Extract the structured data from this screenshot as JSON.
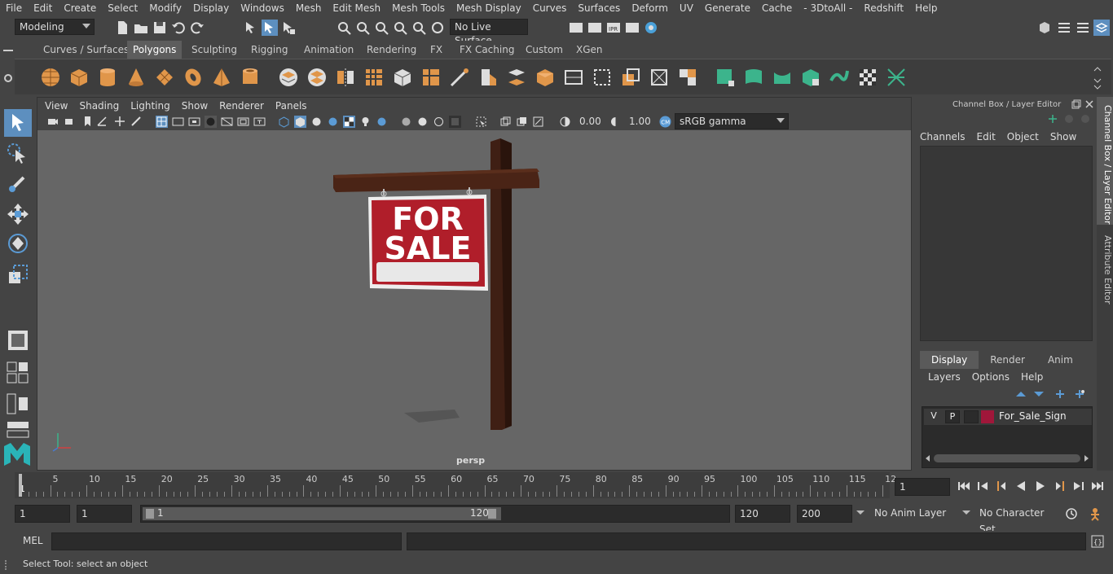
{
  "menubar": {
    "items": [
      "File",
      "Edit",
      "Create",
      "Select",
      "Modify",
      "Display",
      "Windows",
      "Mesh",
      "Edit Mesh",
      "Mesh Tools",
      "Mesh Display",
      "Curves",
      "Surfaces",
      "Deform",
      "UV",
      "Generate",
      "Cache",
      "- 3DtoAll -",
      "Redshift",
      "Help"
    ]
  },
  "statusline": {
    "mode": "Modeling",
    "live_surface": "No Live Surface"
  },
  "shelf": {
    "tabs": [
      "Curves / Surfaces",
      "Polygons",
      "Sculpting",
      "Rigging",
      "Animation",
      "Rendering",
      "FX",
      "FX Caching",
      "Custom",
      "XGen"
    ],
    "active_tab": "Polygons"
  },
  "viewport": {
    "menu": [
      "View",
      "Shading",
      "Lighting",
      "Show",
      "Renderer",
      "Panels"
    ],
    "exposure": "0.00",
    "gamma": "1.00",
    "color_space": "sRGB gamma",
    "camera": "persp",
    "sign_line1": "FOR",
    "sign_line2": "SALE"
  },
  "channel_box": {
    "title": "Channel Box / Layer Editor",
    "menu": [
      "Channels",
      "Edit",
      "Object",
      "Show"
    ],
    "layer_tabs": [
      "Display",
      "Render",
      "Anim"
    ],
    "active_layer_tab": "Display",
    "layer_menu": [
      "Layers",
      "Options",
      "Help"
    ],
    "layer": {
      "v": "V",
      "p": "P",
      "name": "For_Sale_Sign",
      "color": "#a0173a"
    }
  },
  "side_tabs": {
    "channel": "Channel Box / Layer Editor",
    "attribute": "Attribute Editor"
  },
  "timeslider": {
    "ticks": [
      "5",
      "10",
      "15",
      "20",
      "25",
      "30",
      "35",
      "40",
      "45",
      "50",
      "55",
      "60",
      "65",
      "70",
      "75",
      "80",
      "85",
      "90",
      "95",
      "100",
      "105",
      "110",
      "115",
      "12"
    ],
    "start_marker": "1",
    "current_frame": "1"
  },
  "range": {
    "start": "1",
    "playback_start": "1",
    "slider_start": "1",
    "slider_end": "120",
    "playback_end": "120",
    "end": "200",
    "anim_layer": "No Anim Layer",
    "character_set": "No Character Set"
  },
  "cmdline": {
    "label": "MEL"
  },
  "helpline": {
    "text": "Select Tool: select an object"
  },
  "colors": {
    "accent_blue": "#5b9bd5",
    "orange": "#e0964a",
    "green": "#3cb48c",
    "sign_red": "#b01e2a"
  }
}
